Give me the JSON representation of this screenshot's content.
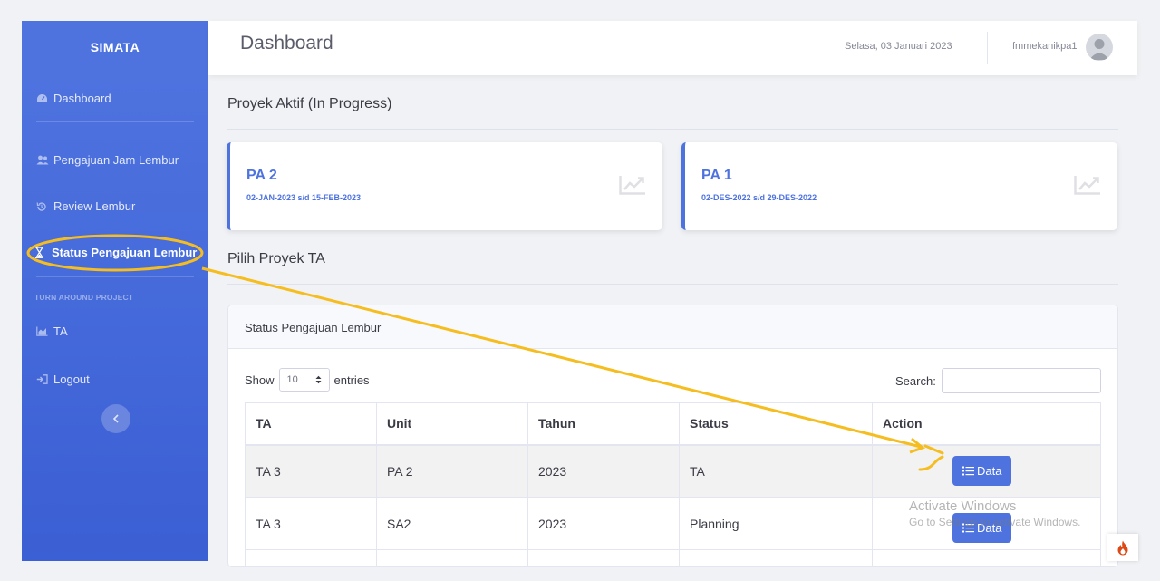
{
  "sidebar": {
    "brand": "SIMATA",
    "items": [
      {
        "label": "Dashboard"
      },
      {
        "label": "Pengajuan Jam Lembur"
      },
      {
        "label": "Review Lembur"
      },
      {
        "label": "Status Pengajuan Lembur"
      },
      {
        "label": "TA"
      },
      {
        "label": "Logout"
      }
    ],
    "heading": "TURN AROUND PROJECT"
  },
  "topbar": {
    "title": "Dashboard",
    "date": "Selasa, 03 Januari 2023",
    "username": "fmmekanikpa1"
  },
  "active_projects": {
    "title": "Proyek Aktif (In Progress)",
    "cards": [
      {
        "name": "PA 2",
        "period": "02-JAN-2023 s/d 15-FEB-2023"
      },
      {
        "name": "PA 1",
        "period": "02-DES-2022 s/d 29-DES-2022"
      }
    ]
  },
  "pick_project": {
    "title": "Pilih Proyek TA"
  },
  "table_card": {
    "header": "Status Pengajuan Lembur",
    "show_label": "Show",
    "entries_value": "10",
    "entries_label": "entries",
    "search_label": "Search:",
    "columns": [
      "TA",
      "Unit",
      "Tahun",
      "Status",
      "Action"
    ],
    "rows": [
      {
        "ta": "TA 3",
        "unit": "PA 2",
        "tahun": "2023",
        "status": "TA",
        "action": "Data"
      },
      {
        "ta": "TA 3",
        "unit": "SA2",
        "tahun": "2023",
        "status": "Planning",
        "action": "Data"
      }
    ]
  },
  "watermark": {
    "line1": "Activate Windows",
    "line2": "Go to Settings to activate Windows."
  },
  "colors": {
    "primary": "#4e73df",
    "annotation": "#f5bd1f"
  }
}
